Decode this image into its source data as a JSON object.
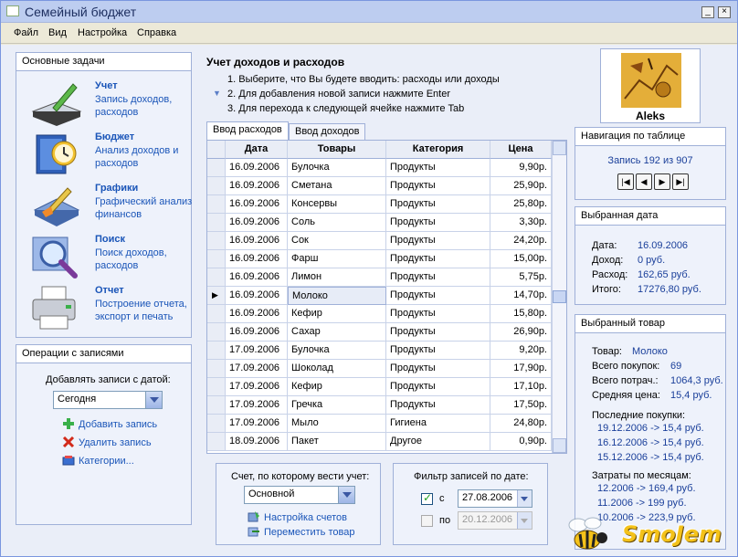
{
  "window": {
    "title": "Семейный бюджет"
  },
  "menu": [
    "Файл",
    "Вид",
    "Настройка",
    "Справка"
  ],
  "tasks": {
    "header": "Основные задачи",
    "items": [
      {
        "name": "Учет",
        "desc": "Запись доходов, расходов",
        "icon": "ledger-pencil-icon"
      },
      {
        "name": "Бюджет",
        "desc": "Анализ доходов и расходов",
        "icon": "clock-book-icon"
      },
      {
        "name": "Графики",
        "desc": "Графический анализ финансов",
        "icon": "brush-chart-icon"
      },
      {
        "name": "Поиск",
        "desc": "Поиск доходов, расходов",
        "icon": "magnifier-icon"
      },
      {
        "name": "Отчет",
        "desc": "Построение отчета, экспорт и печать",
        "icon": "printer-icon"
      }
    ]
  },
  "operations": {
    "header": "Операции с записями",
    "date_label": "Добавлять записи с датой:",
    "date_value": "Сегодня",
    "add": "Добавить запись",
    "delete": "Удалить запись",
    "categories": "Категории..."
  },
  "instructions": {
    "title": "Учет доходов и расходов",
    "steps": [
      "1. Выберите, что Вы будете вводить: расходы или доходы",
      "2. Для добавления новой записи нажмите Enter",
      "3. Для перехода к следующей ячейке нажмите Tab"
    ]
  },
  "tabs": [
    "Ввод расходов",
    "Ввод доходов"
  ],
  "table": {
    "columns": [
      "Дата",
      "Товары",
      "Категория",
      "Цена"
    ],
    "rows": [
      [
        "16.09.2006",
        "Булочка",
        "Продукты",
        "9,90р."
      ],
      [
        "16.09.2006",
        "Сметана",
        "Продукты",
        "25,90р."
      ],
      [
        "16.09.2006",
        "Консервы",
        "Продукты",
        "25,80р."
      ],
      [
        "16.09.2006",
        "Соль",
        "Продукты",
        "3,30р."
      ],
      [
        "16.09.2006",
        "Сок",
        "Продукты",
        "24,20р."
      ],
      [
        "16.09.2006",
        "Фарш",
        "Продукты",
        "15,00р."
      ],
      [
        "16.09.2006",
        "Лимон",
        "Продукты",
        "5,75р."
      ],
      [
        "16.09.2006",
        "Молоко",
        "Продукты",
        "14,70р."
      ],
      [
        "16.09.2006",
        "Кефир",
        "Продукты",
        "15,80р."
      ],
      [
        "16.09.2006",
        "Сахар",
        "Продукты",
        "26,90р."
      ],
      [
        "17.09.2006",
        "Булочка",
        "Продукты",
        "9,20р."
      ],
      [
        "17.09.2006",
        "Шоколад",
        "Продукты",
        "17,90р."
      ],
      [
        "17.09.2006",
        "Кефир",
        "Продукты",
        "17,10р."
      ],
      [
        "17.09.2006",
        "Гречка",
        "Продукты",
        "17,50р."
      ],
      [
        "17.09.2006",
        "Мыло",
        "Гигиена",
        "24,80р."
      ],
      [
        "18.09.2006",
        "Пакет",
        "Другое",
        "0,90р."
      ]
    ],
    "current_marker": "▶"
  },
  "account": {
    "label": "Счет, по которому вести учет:",
    "value": "Основной",
    "settings": "Настройка счетов",
    "move": "Переместить товар"
  },
  "filter": {
    "label": "Фильтр записей по дате:",
    "from_label": "с",
    "from_value": "27.08.2006",
    "to_label": "по",
    "to_value": "20.12.2006"
  },
  "user": {
    "name": "Aleks"
  },
  "navigation": {
    "header": "Навигация по таблице",
    "record_text": "Запись 192 из 907",
    "buttons": [
      "|◀",
      "◀",
      "▶",
      "▶|"
    ]
  },
  "selected_date": {
    "header": "Выбранная дата",
    "date_label": "Дата:",
    "date_value": "16.09.2006",
    "income_label": "Доход:",
    "income_value": "0 руб.",
    "expense_label": "Расход:",
    "expense_value": "162,65 руб.",
    "total_label": "Итого:",
    "total_value": "17276,80 руб."
  },
  "selected_item": {
    "header": "Выбранный товар",
    "item_label": "Товар:",
    "item_value": "Молоко",
    "count_label": "Всего покупок:",
    "count_value": "69",
    "spent_label": "Всего потрач.:",
    "spent_value": "1064,3 руб.",
    "avg_label": "Средняя цена:",
    "avg_value": "15,4 руб.",
    "recent_label": "Последние покупки:",
    "recent": [
      "19.12.2006 -> 15,4 руб.",
      "16.12.2006 -> 15,4 руб.",
      "15.12.2006 -> 15,4 руб."
    ],
    "monthly_label": "Затраты по месяцам:",
    "monthly": [
      "12.2006 -> 169,4 руб.",
      "11.2006 -> 199 руб.",
      "10.2006 -> 223,9 руб."
    ]
  },
  "watermark": "SmoJem"
}
